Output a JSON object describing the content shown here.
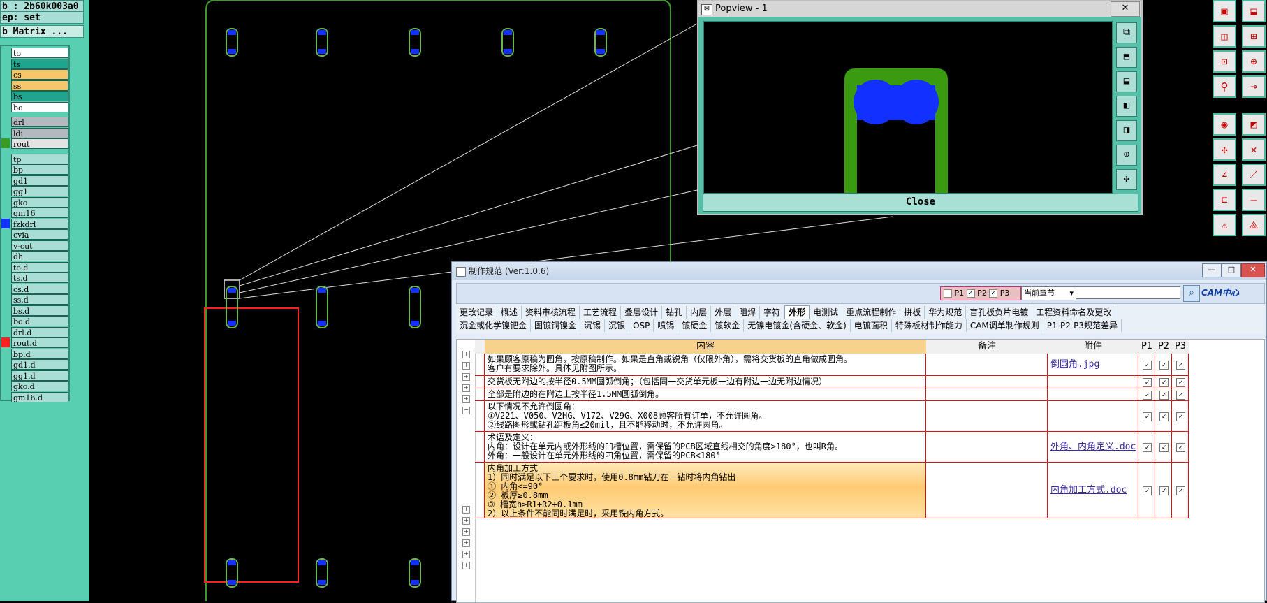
{
  "left_panel": {
    "job_line": "b : 2b60k003a0",
    "step_line": "ep: set",
    "matrix_button": "b Matrix ...",
    "layers_a": [
      {
        "name": "to",
        "color": "#ffffff"
      },
      {
        "name": "ts",
        "color": "#1fa48e"
      },
      {
        "name": "cs",
        "color": "#f7c66b"
      },
      {
        "name": "ss",
        "color": "#f7c66b"
      },
      {
        "name": "bs",
        "color": "#1fa48e"
      },
      {
        "name": "bo",
        "color": "#ffffff"
      }
    ],
    "layers_b": [
      {
        "name": "drl",
        "color": "#b3b9be"
      },
      {
        "name": "ldi",
        "color": "#b3b9be"
      },
      {
        "name": "rout",
        "color": "#e3e3e3"
      }
    ],
    "layers_c": [
      "tp",
      "bp",
      "gd1",
      "gg1",
      "gko",
      "gm16",
      "fzkdrl",
      "cvia",
      "v-cut",
      "dh",
      "to.d",
      "ts.d",
      "cs.d",
      "ss.d",
      "bs.d",
      "bo.d",
      "drl.d",
      "rout.d",
      "bp.d",
      "gd1.d",
      "gg1.d",
      "gko.d",
      "gm16.d"
    ]
  },
  "popview": {
    "title": "Popview - 1",
    "close_x": "✕",
    "close_button": "Close",
    "icon_glyph": "⊠"
  },
  "spec_window": {
    "title": "制作规范 (Ver:1.0.6)",
    "min": "—",
    "max": "□",
    "close": "✕",
    "toolbar": {
      "p1": "P1",
      "p2": "P2",
      "p3": "P3",
      "scope_select": "当前章节",
      "search_value": "",
      "brand": "CAM中心"
    },
    "tabs_row1": [
      "更改记录",
      "概述",
      "资料审核流程",
      "工艺流程",
      "叠层设计",
      "钻孔",
      "内层",
      "外层",
      "阻焊",
      "字符",
      "外形",
      "电测试",
      "重点流程制作",
      "拼板",
      "华为规范",
      "盲孔板负片电镀",
      "工程资料命名及更改"
    ],
    "active_tab": "外形",
    "tabs_row2": [
      "沉金或化学镍钯金",
      "图镀铜镍金",
      "沉锡",
      "沉银",
      "OSP",
      "喷锡",
      "镀硬金",
      "镀软金",
      "无镍电镀金(含硬金、软金)",
      "电镀面积",
      "特殊板材制作能力",
      "CAM调单制作规则",
      "P1-P2-P3规范差异"
    ],
    "columns": {
      "content": "内容",
      "remark": "备注",
      "attach": "附件",
      "p1": "P1",
      "p2": "P2",
      "p3": "P3"
    },
    "rows": [
      {
        "content": "如果顾客原稿为圆角，按原稿制作。如果是直角或锐角（仅限外角），需将交货板的直角做成圆角。\n客户有要求除外。具体见附图所示。",
        "remark": "",
        "attach": "倒圆角.jpg"
      },
      {
        "content": "交货板无附边的按半径0.5MM圆弧倒角；（包括同一交货单元板一边有附边一边无附边情况）",
        "remark": "",
        "attach": ""
      },
      {
        "content": "全部是附边的在附边上按半径1.5MM圆弧倒角。",
        "remark": "",
        "attach": ""
      },
      {
        "content": "以下情况不允许倒圆角：\n①V221、V050、V2HG、V172、V29G、X008顾客所有订单，不允许圆角。\n②线路图形或钻孔距板角≤20mil，且不能移动时，不允许圆角。",
        "remark": "",
        "attach": ""
      },
      {
        "content": "术语及定义：\n内角：设计在单元内或外形线的凹槽位置，需保留的PCB区域直线相交的角度>180°，也叫R角。\n外角：一般设计在单元外形线的四角位置，需保留的PCB<180°",
        "remark": "",
        "attach": "外角、内角定义.doc"
      },
      {
        "content": "内角加工方式\n1）同时满足以下三个要求时，使用0.8mm钻刀在一钻时将内角钻出\n① 内角<=90°\n② 板厚≥0.8mm\n③ 槽宽h≥R1+R2+0.1mm\n2）以上条件不能同时满足时，采用铣内角方式。",
        "remark": "",
        "attach": "内角加工方式.doc"
      }
    ],
    "check": "✓",
    "expander_plus": "+",
    "expander_minus": "−"
  },
  "right_toolbar": {
    "buttons": [
      "▣",
      "⬓",
      "◫",
      "⊞",
      "⊡",
      "⊕",
      "⚲",
      "⊸",
      "◉",
      "◩",
      "✣",
      "✕",
      "∠",
      "⟋",
      "⊏",
      "—",
      "⚠",
      "⟁"
    ]
  },
  "colors": {
    "panel_teal": "#59cfb1",
    "board_outline": "#3a9c25",
    "slot_green": "#6ab84a",
    "pad_blue": "#1230ff",
    "highlight_red": "#ff2020",
    "popview_green": "#3a9a10"
  }
}
